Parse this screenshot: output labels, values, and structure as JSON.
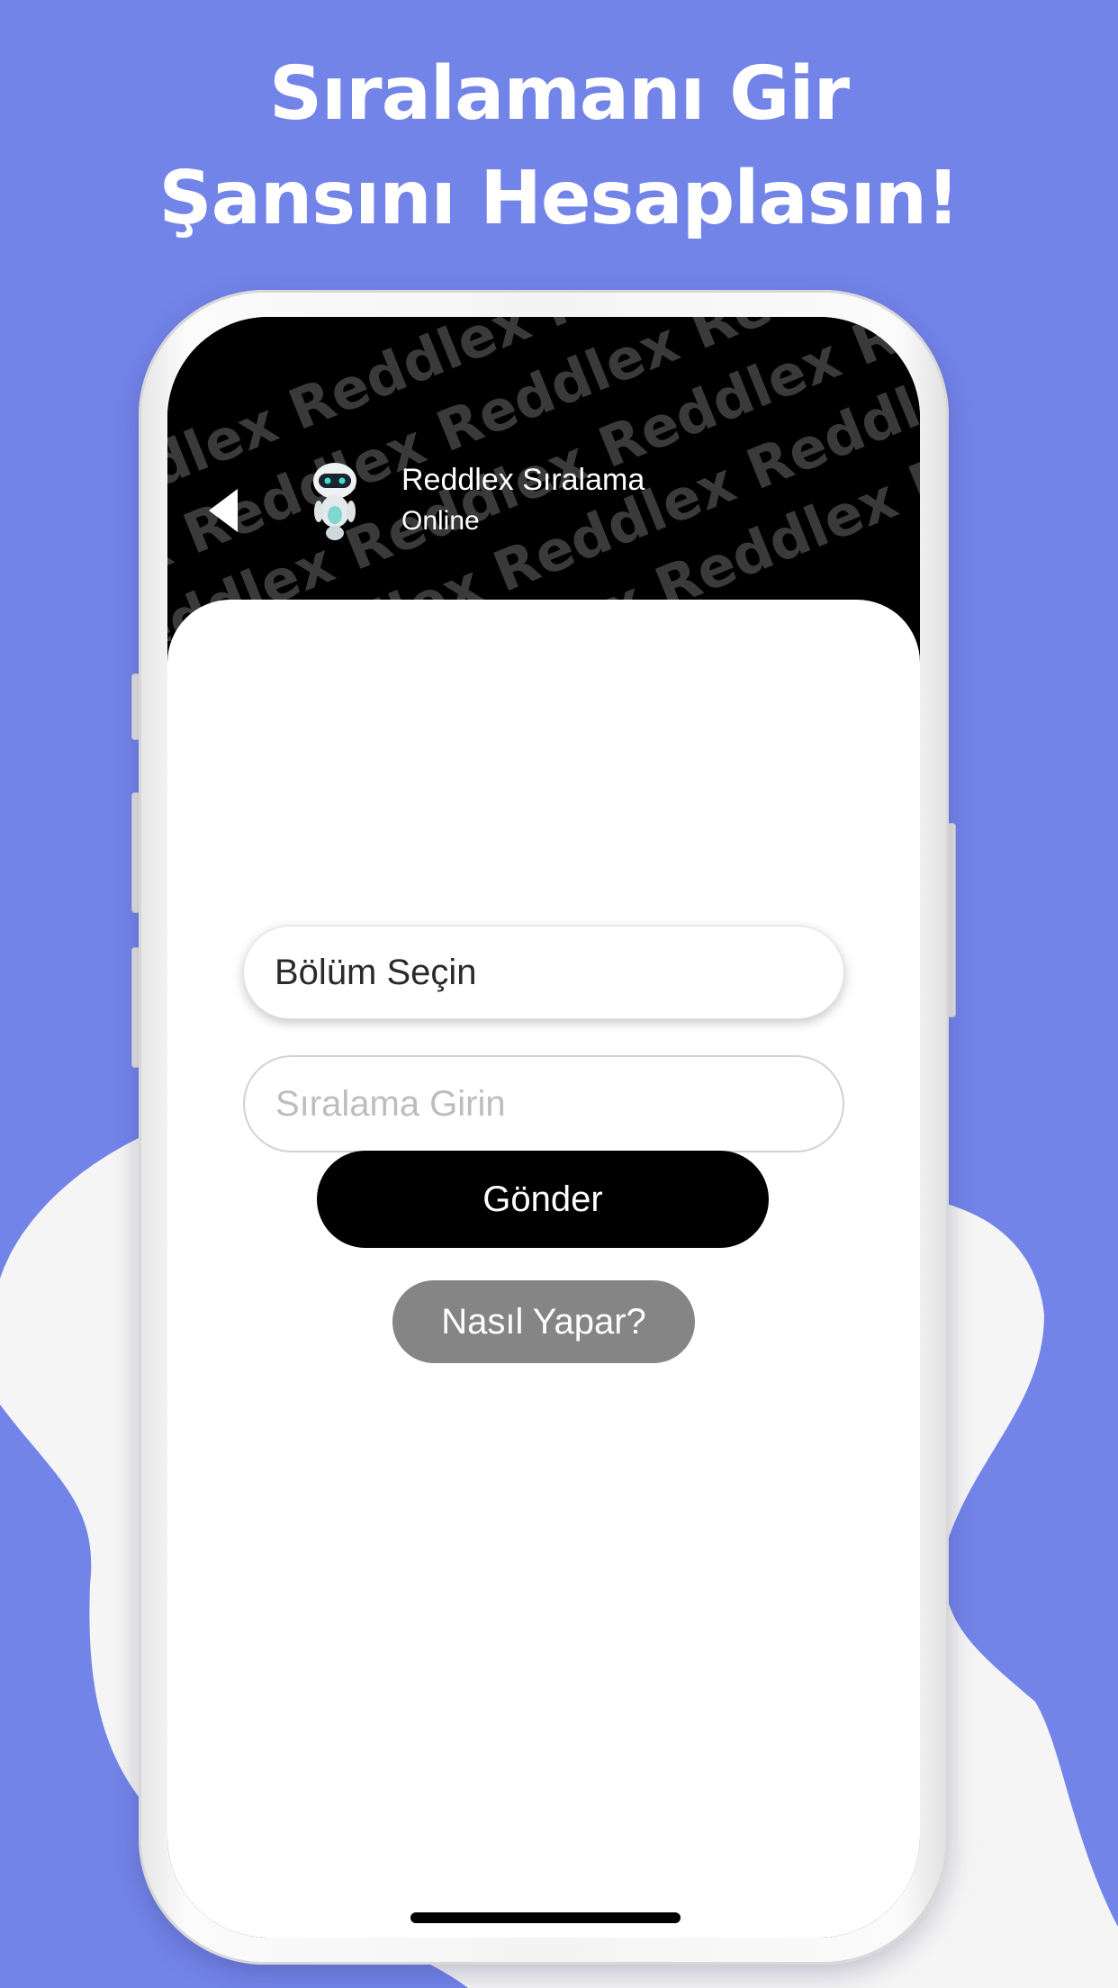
{
  "headline": {
    "line1": "Sıralamanı Gir",
    "line2": "Şansını Hesaplasın!"
  },
  "header": {
    "title": "Reddlex Sıralama",
    "status": "Online",
    "watermark_text": "Reddlex",
    "back_icon": "back-arrow-icon",
    "avatar_icon": "robot-avatar-icon"
  },
  "form": {
    "department_select": {
      "value": "Bölüm Seçin"
    },
    "rank_input": {
      "placeholder": "Sıralama Girin"
    },
    "submit_button": "Gönder",
    "howto_button": "Nasıl Yapar?"
  },
  "colors": {
    "background": "#7384e9",
    "blob": "#f5f5f5",
    "header": "#000000",
    "primary_button": "#000000",
    "secondary_button": "#858585"
  }
}
